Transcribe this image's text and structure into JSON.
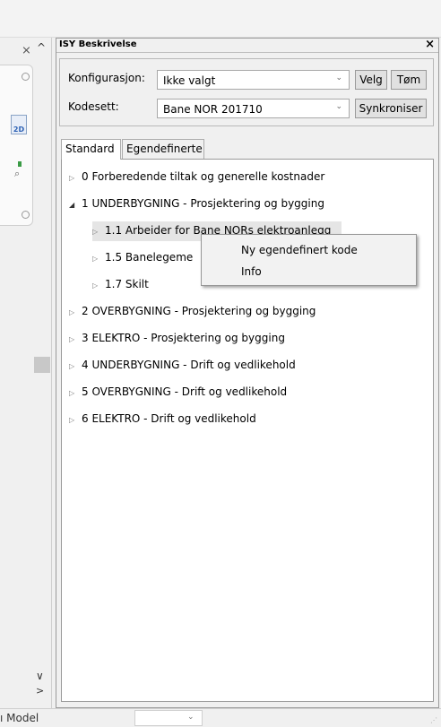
{
  "left_strip": {
    "close_glyph": "⨯",
    "up_glyph": "^",
    "down_glyph": "∨",
    "expand_glyph": ">"
  },
  "panel": {
    "title": "ISY Beskrivelse",
    "close_glyph": "×",
    "konfigurasjon_label": "Konfigurasjon:",
    "konfigurasjon_value": "Ikke valgt",
    "velg_label": "Velg",
    "tom_label": "Tøm",
    "kodesett_label": "Kodesett:",
    "kodesett_value": "Bane NOR 201710",
    "synkroniser_label": "Synkroniser",
    "tabs": [
      "Standard",
      "Egendefinerte"
    ]
  },
  "tree": {
    "items": [
      {
        "label": "0 Forberedende tiltak og generelle kostnader",
        "expanded": false
      },
      {
        "label": "1 UNDERBYGNING - Prosjektering og bygging",
        "expanded": true
      },
      {
        "label": "1.1 Arbeider for Bane NORs elektroanlegg",
        "expanded": false
      },
      {
        "label": "1.5 Banelegeme",
        "expanded": false
      },
      {
        "label": "1.7 Skilt",
        "expanded": false
      },
      {
        "label": "2 OVERBYGNING - Prosjektering og bygging",
        "expanded": false
      },
      {
        "label": "3 ELEKTRO - Prosjektering og bygging",
        "expanded": false
      },
      {
        "label": "4 UNDERBYGNING - Drift og vedlikehold",
        "expanded": false
      },
      {
        "label": "5 OVERBYGNING - Drift og vedlikehold",
        "expanded": false
      },
      {
        "label": "6 ELEKTRO - Drift og vedlikehold",
        "expanded": false
      }
    ]
  },
  "context_menu": {
    "items": [
      "Ny egendefinert kode",
      "Info"
    ]
  },
  "statusbar": {
    "text": "ı Model"
  },
  "colors": {
    "background": "#f0f0f0",
    "selected_row": "#e5e5e5",
    "menu_bg": "#f2f2f2"
  },
  "icons": {
    "collapsed": "triangle-right-icon",
    "expanded": "triangle-down-icon",
    "dropdown": "chevron-down-icon"
  }
}
